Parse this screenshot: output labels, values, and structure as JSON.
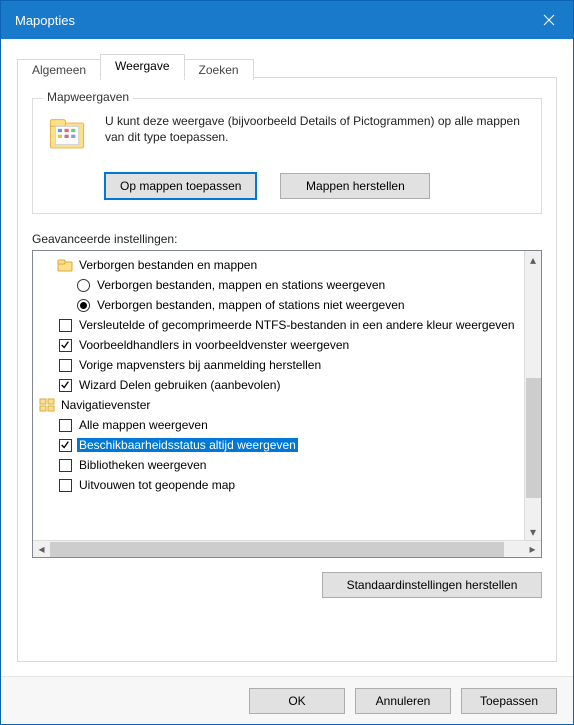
{
  "window": {
    "title": "Mapopties"
  },
  "tabs": {
    "general": "Algemeen",
    "view": "Weergave",
    "search": "Zoeken"
  },
  "group": {
    "legend": "Mapweergaven",
    "desc": "U kunt deze weergave (bijvoorbeeld Details of Pictogrammen) op alle mappen van dit type toepassen.",
    "apply": "Op mappen toepassen",
    "reset": "Mappen herstellen"
  },
  "adv": {
    "label": "Geavanceerde instellingen:",
    "items": [
      {
        "kind": "folder",
        "text": "Verborgen bestanden en mappen",
        "indent": 1
      },
      {
        "kind": "radio",
        "text": "Verborgen bestanden, mappen en stations weergeven",
        "checked": false,
        "indent": 2
      },
      {
        "kind": "radio",
        "text": "Verborgen bestanden, mappen of stations niet weergeven",
        "checked": true,
        "indent": 2
      },
      {
        "kind": "check",
        "text": "Versleutelde of gecomprimeerde NTFS-bestanden in een andere kleur weergeven",
        "checked": false,
        "indent": 1
      },
      {
        "kind": "check",
        "text": "Voorbeeldhandlers in voorbeeldvenster weergeven",
        "checked": true,
        "indent": 1
      },
      {
        "kind": "check",
        "text": "Vorige mapvensters bij aanmelding herstellen",
        "checked": false,
        "indent": 1
      },
      {
        "kind": "check",
        "text": "Wizard Delen gebruiken (aanbevolen)",
        "checked": true,
        "indent": 1
      },
      {
        "kind": "navicon",
        "text": "Navigatievenster",
        "indent": 0
      },
      {
        "kind": "check",
        "text": "Alle mappen weergeven",
        "checked": false,
        "indent": 1
      },
      {
        "kind": "check",
        "text": "Beschikbaarheidsstatus altijd weergeven",
        "checked": true,
        "indent": 1,
        "selected": true
      },
      {
        "kind": "check",
        "text": "Bibliotheken weergeven",
        "checked": false,
        "indent": 1
      },
      {
        "kind": "check",
        "text": "Uitvouwen tot geopende map",
        "checked": false,
        "indent": 1
      }
    ],
    "restore": "Standaardinstellingen herstellen"
  },
  "buttons": {
    "ok": "OK",
    "cancel": "Annuleren",
    "apply": "Toepassen"
  }
}
